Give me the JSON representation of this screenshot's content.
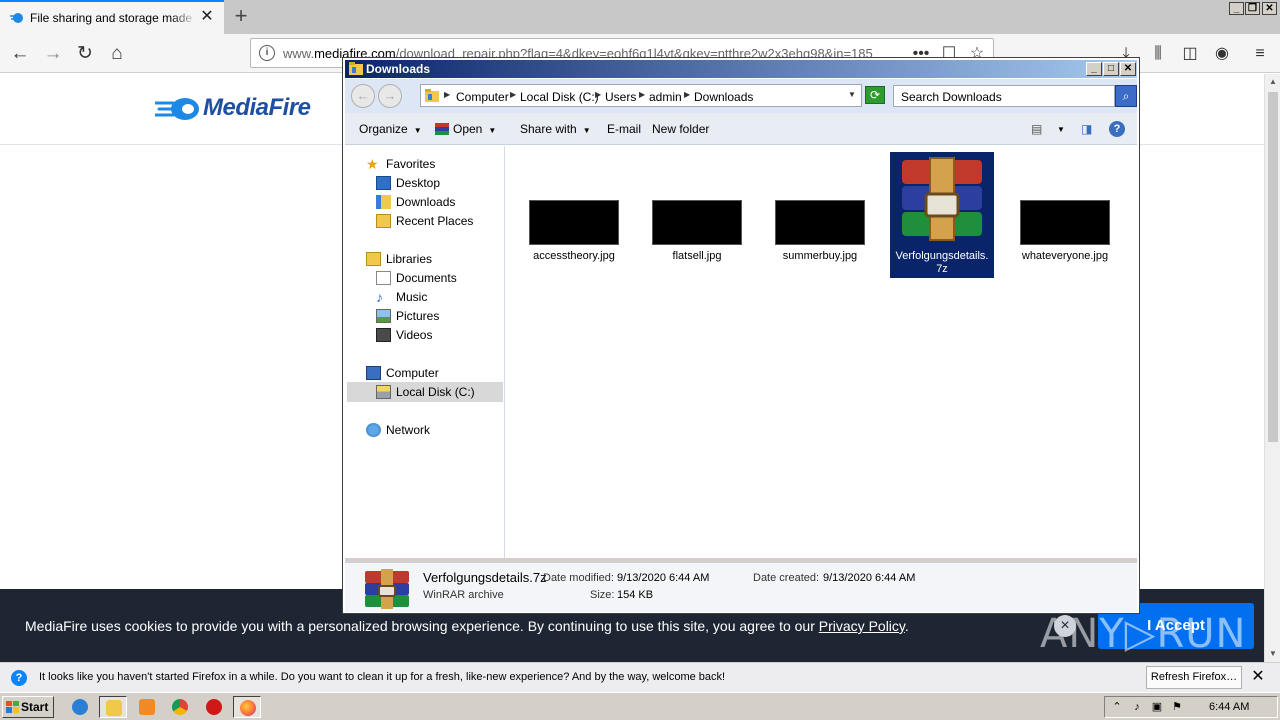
{
  "browser": {
    "tab_title": "File sharing and storage made simple",
    "url_prefix": "www.",
    "url_domain": "mediafire.com",
    "url_path": "/download_repair.php?flag=4&dkey=eohf6g1l4vt&qkey=ntthre2w2x3ehg98&in=185"
  },
  "page": {
    "logo_text": "MediaFire",
    "cookie_text": "MediaFire uses cookies to provide you with a personalized browsing experience. By continuing to use this site, you agree to our ",
    "cookie_link": "Privacy Policy",
    "cookie_period": ".",
    "cookie_accept": "I Accept",
    "watermark": "ANY▷RUN"
  },
  "notification": {
    "text": "It looks like you haven't started Firefox in a while. Do you want to clean it up for a fresh, like-new experience? And by the way, welcome back!",
    "button": "Refresh Firefox…"
  },
  "explorer": {
    "title": "Downloads",
    "breadcrumb": [
      "Computer",
      "Local Disk (C:)",
      "Users",
      "admin",
      "Downloads"
    ],
    "search_placeholder": "Search Downloads",
    "commands": {
      "organize": "Organize",
      "open": "Open",
      "share_with": "Share with",
      "email": "E-mail",
      "new_folder": "New folder"
    },
    "nav": {
      "favorites": "Favorites",
      "desktop": "Desktop",
      "downloads": "Downloads",
      "recent_places": "Recent Places",
      "libraries": "Libraries",
      "documents": "Documents",
      "music": "Music",
      "pictures": "Pictures",
      "videos": "Videos",
      "computer": "Computer",
      "local_disk": "Local Disk (C:)",
      "network": "Network"
    },
    "files": [
      {
        "name": "accesstheory.jpg"
      },
      {
        "name": "flatsell.jpg"
      },
      {
        "name": "summerbuy.jpg"
      },
      {
        "name": "Verfolgungsdetails.7z"
      },
      {
        "name": "whateveryone.jpg"
      }
    ],
    "details": {
      "name": "Verfolgungsdetails.7z",
      "type": "WinRAR archive",
      "modified_label": "Date modified:",
      "modified_value": "9/13/2020 6:44 AM",
      "created_label": "Date created:",
      "created_value": "9/13/2020 6:44 AM",
      "size_label": "Size:",
      "size_value": "154 KB"
    }
  },
  "taskbar": {
    "start": "Start",
    "clock": "6:44 AM"
  },
  "colors": {
    "firefox_accent": "#0a84ff",
    "mediafire_blue": "#1f4fa0",
    "cookie_bg": "#1e2634",
    "accept_button": "#0070f0",
    "selection": "#0a246a"
  }
}
